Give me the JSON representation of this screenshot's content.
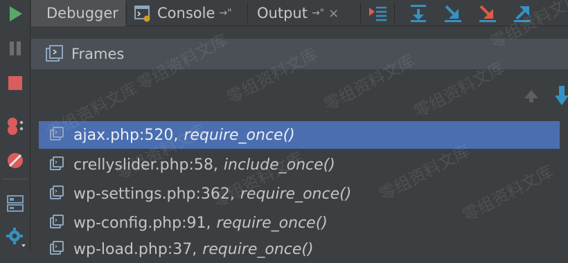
{
  "tabs": [
    {
      "label": "Debugger",
      "active": true
    },
    {
      "label": "Console",
      "pin": "→\"",
      "active": false
    },
    {
      "label": "Output",
      "pin": "→\"",
      "close": "×",
      "active": false
    }
  ],
  "frames": {
    "title": "Frames",
    "items": [
      {
        "location": "ajax.php:520,",
        "function": "require_once()",
        "selected": true
      },
      {
        "location": "crellyslider.php:58,",
        "function": "include_once()",
        "selected": false
      },
      {
        "location": "wp-settings.php:362,",
        "function": "require_once()",
        "selected": false
      },
      {
        "location": "wp-config.php:91,",
        "function": "require_once()",
        "selected": false
      },
      {
        "location": "wp-load.php:37,",
        "function": "require_once()",
        "selected": false
      }
    ]
  },
  "left_toolbar_icons": [
    "resume-icon",
    "pause-icon",
    "stop-icon",
    "view-breakpoints-icon",
    "mute-breakpoints-icon",
    "layout-icon",
    "settings-icon"
  ],
  "top_toolbar_icons": [
    "show-execution-point-icon",
    "step-over-icon",
    "step-into-icon",
    "step-out-icon",
    "run-to-cursor-icon",
    "evaluate-icon"
  ],
  "watermark": "零组资料文库",
  "colors": {
    "background": "#3c3f41",
    "header": "#4b5057",
    "selection": "#4a6eaf",
    "run_green": "#59a869",
    "stop_red": "#db5c5c",
    "step_blue": "#3592c4"
  }
}
